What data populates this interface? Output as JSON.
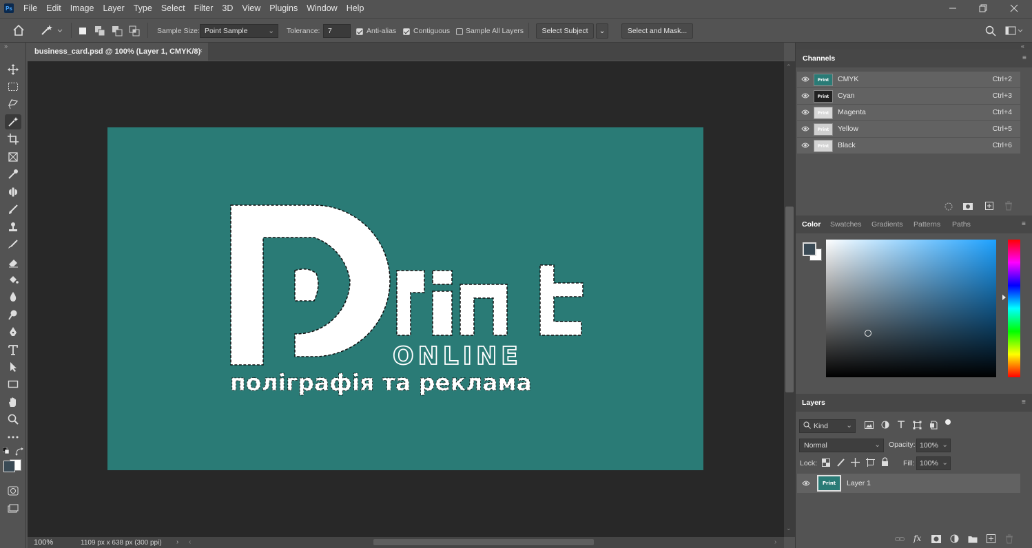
{
  "menu": {
    "app_icon": "Ps",
    "items": [
      "File",
      "Edit",
      "Image",
      "Layer",
      "Type",
      "Select",
      "Filter",
      "3D",
      "View",
      "Plugins",
      "Window",
      "Help"
    ]
  },
  "window_controls": [
    "minimize-icon",
    "restore-icon",
    "close-icon"
  ],
  "options": {
    "sample_size_label": "Sample Size:",
    "sample_size_value": "Point Sample",
    "tolerance_label": "Tolerance:",
    "tolerance_value": "7",
    "anti_alias": "Anti-alias",
    "contiguous": "Contiguous",
    "sample_all_layers": "Sample All Layers",
    "select_subject": "Select Subject",
    "select_and_mask": "Select and Mask..."
  },
  "document": {
    "tab_title": "business_card.psd @ 100% (Layer 1, CMYK/8)",
    "zoom": "100%",
    "size_info": "1109 px x 638 px (300 ppi)",
    "bg_color": "#2a7b76",
    "logo_main": "Print",
    "logo_sub": "ONLINE",
    "logo_tagline": "поліграфія та реклама"
  },
  "channels": {
    "title": "Channels",
    "rows": [
      {
        "name": "CMYK",
        "shortcut": "Ctrl+2",
        "thumb": "Print"
      },
      {
        "name": "Cyan",
        "shortcut": "Ctrl+3",
        "thumb": "Print"
      },
      {
        "name": "Magenta",
        "shortcut": "Ctrl+4",
        "thumb": "Print"
      },
      {
        "name": "Yellow",
        "shortcut": "Ctrl+5",
        "thumb": "Print"
      },
      {
        "name": "Black",
        "shortcut": "Ctrl+6",
        "thumb": "Print"
      }
    ]
  },
  "color_tabs": [
    "Color",
    "Swatches",
    "Gradients",
    "Patterns",
    "Paths"
  ],
  "layers": {
    "title": "Layers",
    "kind": "Kind",
    "blend": "Normal",
    "opacity_label": "Opacity:",
    "opacity": "100%",
    "lock_label": "Lock:",
    "fill_label": "Fill:",
    "fill": "100%",
    "layer_name": "Layer 1",
    "layer_thumb": "Print"
  },
  "colors": {
    "foreground": "#3a4a55",
    "background": "#ffffff",
    "accent": "#2a7b76"
  }
}
